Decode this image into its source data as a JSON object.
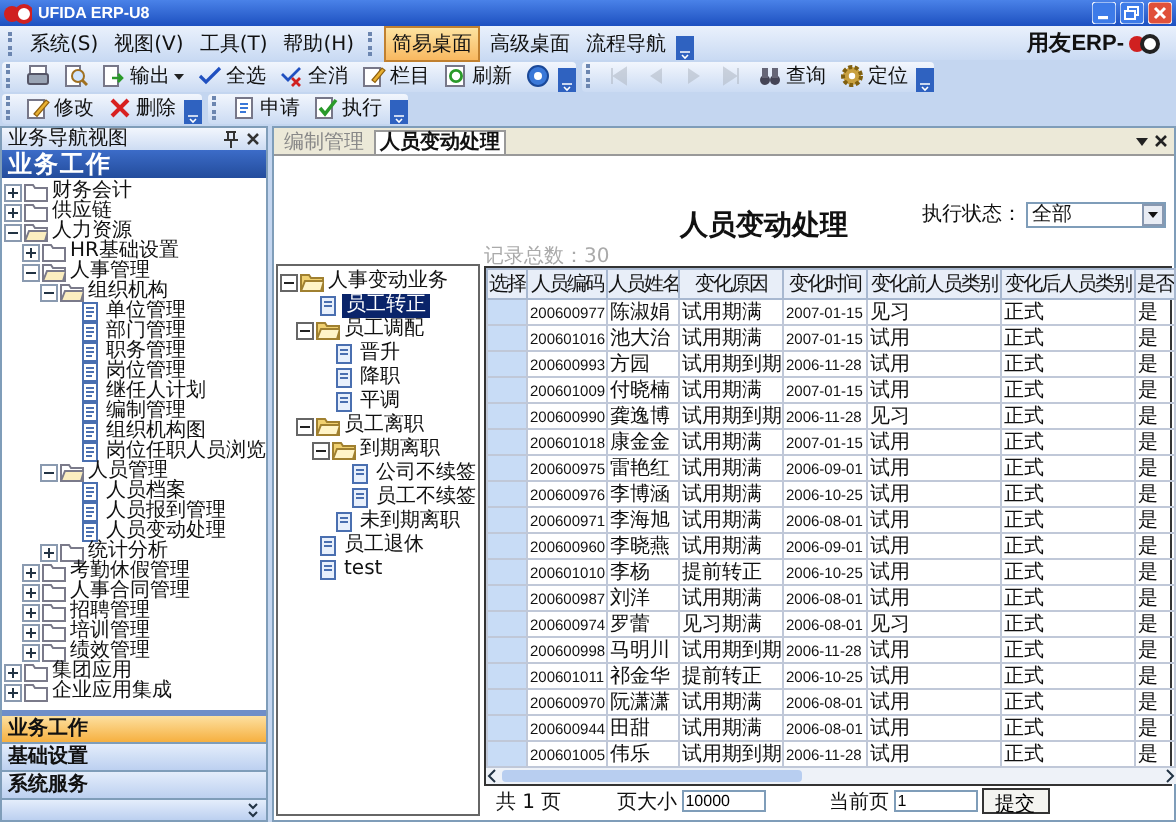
{
  "window": {
    "title": "UFIDA ERP-U8"
  },
  "menu": [
    "系统(S)",
    "视图(V)",
    "工具(T)",
    "帮助(H)"
  ],
  "desktop_tabs": [
    {
      "label": "简易桌面",
      "selected": true
    },
    {
      "label": "高级桌面",
      "selected": false
    },
    {
      "label": "流程导航",
      "selected": false
    }
  ],
  "brand": "用友ERP-",
  "toolbar_rows": [
    [
      [
        {
          "kind": "icon",
          "disabled": false
        },
        {
          "kind": "icon",
          "disabled": false
        },
        {
          "kind": "dropdown",
          "label": "输出",
          "disabled": false
        },
        {
          "kind": "button",
          "label": "全选",
          "disabled": false
        },
        {
          "kind": "button",
          "label": "全消",
          "disabled": false
        },
        {
          "kind": "button",
          "label": "栏目",
          "disabled": false
        },
        {
          "kind": "button",
          "label": "刷新",
          "disabled": false
        },
        {
          "kind": "icon",
          "disabled": false
        }
      ],
      [
        {
          "kind": "icon",
          "disabled": true
        },
        {
          "kind": "icon",
          "disabled": true
        },
        {
          "kind": "icon",
          "disabled": true
        },
        {
          "kind": "icon",
          "disabled": true
        },
        {
          "kind": "button",
          "label": "查询",
          "disabled": false
        },
        {
          "kind": "button",
          "label": "定位",
          "disabled": false
        }
      ]
    ],
    [
      [
        {
          "kind": "button",
          "label": "修改",
          "disabled": false
        },
        {
          "kind": "button",
          "label": "删除",
          "disabled": false
        }
      ],
      [
        {
          "kind": "button",
          "label": "申请",
          "disabled": false
        },
        {
          "kind": "button",
          "label": "执行",
          "disabled": false
        }
      ]
    ]
  ],
  "nav": {
    "title": "业务导航视图",
    "heading": "业务工作",
    "tree": [
      {
        "label": "财务会计",
        "kind": "folder",
        "expanded": false
      },
      {
        "label": "供应链",
        "kind": "folder",
        "expanded": false
      },
      {
        "label": "人力资源",
        "kind": "folder",
        "expanded": true,
        "children": [
          {
            "label": "HR基础设置",
            "kind": "folder",
            "expanded": false
          },
          {
            "label": "人事管理",
            "kind": "folder",
            "expanded": true,
            "children": [
              {
                "label": "组织机构",
                "kind": "folder",
                "expanded": true,
                "children": [
                  {
                    "label": "单位管理",
                    "kind": "doc"
                  },
                  {
                    "label": "部门管理",
                    "kind": "doc"
                  },
                  {
                    "label": "职务管理",
                    "kind": "doc"
                  },
                  {
                    "label": "岗位管理",
                    "kind": "doc"
                  },
                  {
                    "label": "继任人计划",
                    "kind": "doc"
                  },
                  {
                    "label": "编制管理",
                    "kind": "doc"
                  },
                  {
                    "label": "组织机构图",
                    "kind": "doc"
                  },
                  {
                    "label": "岗位任职人员浏览",
                    "kind": "doc"
                  }
                ]
              },
              {
                "label": "人员管理",
                "kind": "folder",
                "expanded": true,
                "children": [
                  {
                    "label": "人员档案",
                    "kind": "doc"
                  },
                  {
                    "label": "人员报到管理",
                    "kind": "doc"
                  },
                  {
                    "label": "人员变动处理",
                    "kind": "doc"
                  }
                ]
              },
              {
                "label": "统计分析",
                "kind": "folder",
                "expanded": false
              }
            ]
          },
          {
            "label": "考勤休假管理",
            "kind": "folder",
            "expanded": false
          },
          {
            "label": "人事合同管理",
            "kind": "folder",
            "expanded": false
          },
          {
            "label": "招聘管理",
            "kind": "folder",
            "expanded": false
          },
          {
            "label": "培训管理",
            "kind": "folder",
            "expanded": false
          },
          {
            "label": "绩效管理",
            "kind": "folder",
            "expanded": false
          }
        ]
      },
      {
        "label": "集团应用",
        "kind": "folder",
        "expanded": false
      },
      {
        "label": "企业应用集成",
        "kind": "folder",
        "expanded": false
      }
    ],
    "sections": [
      {
        "label": "业务工作",
        "selected": true
      },
      {
        "label": "基础设置",
        "selected": false
      },
      {
        "label": "系统服务",
        "selected": false
      }
    ]
  },
  "tabs": [
    {
      "label": "编制管理",
      "selected": false
    },
    {
      "label": "人员变动处理",
      "selected": true
    }
  ],
  "page": {
    "title": "人员变动处理",
    "record_count": "记录总数：30",
    "status_label": "执行状态：",
    "status_value": "全部"
  },
  "process_tree": [
    {
      "label": "人事变动业务",
      "kind": "folder",
      "expanded": true,
      "selected": false,
      "children": [
        {
          "label": "员工转正",
          "kind": "doc",
          "selected": true
        },
        {
          "label": "员工调配",
          "kind": "folder",
          "expanded": true,
          "selected": false,
          "children": [
            {
              "label": "晋升",
              "kind": "doc",
              "selected": false
            },
            {
              "label": "降职",
              "kind": "doc",
              "selected": false
            },
            {
              "label": "平调",
              "kind": "doc",
              "selected": false
            }
          ]
        },
        {
          "label": "员工离职",
          "kind": "folder",
          "expanded": true,
          "selected": false,
          "children": [
            {
              "label": "到期离职",
              "kind": "folder",
              "expanded": true,
              "selected": false,
              "children": [
                {
                  "label": "公司不续签",
                  "kind": "doc",
                  "selected": false
                },
                {
                  "label": "员工不续签",
                  "kind": "doc",
                  "selected": false
                }
              ]
            },
            {
              "label": "未到期离职",
              "kind": "doc",
              "selected": false
            }
          ]
        },
        {
          "label": "员工退休",
          "kind": "doc",
          "selected": false
        },
        {
          "label": "test",
          "kind": "doc",
          "selected": false
        }
      ]
    }
  ],
  "table": {
    "columns": [
      "选择",
      "人员编码",
      "人员姓名",
      "变化原因",
      "变化时间",
      "变化前人员类别",
      "变化后人员类别",
      "是否"
    ],
    "rows": [
      [
        "",
        "200600977",
        "陈淑娟",
        "试用期满",
        "2007-01-15",
        "见习",
        "正式",
        "是"
      ],
      [
        "",
        "200601016",
        "池大治",
        "试用期满",
        "2007-01-15",
        "试用",
        "正式",
        "是"
      ],
      [
        "",
        "200600993",
        "方园",
        "试用期到期",
        "2006-11-28",
        "试用",
        "正式",
        "是"
      ],
      [
        "",
        "200601009",
        "付晓楠",
        "试用期满",
        "2007-01-15",
        "试用",
        "正式",
        "是"
      ],
      [
        "",
        "200600990",
        "龚逸博",
        "试用期到期",
        "2006-11-28",
        "见习",
        "正式",
        "是"
      ],
      [
        "",
        "200601018",
        "康金金",
        "试用期满",
        "2007-01-15",
        "试用",
        "正式",
        "是"
      ],
      [
        "",
        "200600975",
        "雷艳红",
        "试用期满",
        "2006-09-01",
        "试用",
        "正式",
        "是"
      ],
      [
        "",
        "200600976",
        "李博涵",
        "试用期满",
        "2006-10-25",
        "试用",
        "正式",
        "是"
      ],
      [
        "",
        "200600971",
        "李海旭",
        "试用期满",
        "2006-08-01",
        "试用",
        "正式",
        "是"
      ],
      [
        "",
        "200600960",
        "李晓燕",
        "试用期满",
        "2006-09-01",
        "试用",
        "正式",
        "是"
      ],
      [
        "",
        "200601010",
        "李杨",
        "提前转正",
        "2006-10-25",
        "试用",
        "正式",
        "是"
      ],
      [
        "",
        "200600987",
        "刘洋",
        "试用期满",
        "2006-08-01",
        "试用",
        "正式",
        "是"
      ],
      [
        "",
        "200600974",
        "罗蕾",
        "见习期满",
        "2006-08-01",
        "见习",
        "正式",
        "是"
      ],
      [
        "",
        "200600998",
        "马明川",
        "试用期到期",
        "2006-11-28",
        "试用",
        "正式",
        "是"
      ],
      [
        "",
        "200601011",
        "祁金华",
        "提前转正",
        "2006-10-25",
        "试用",
        "正式",
        "是"
      ],
      [
        "",
        "200600970",
        "阮潇潇",
        "试用期满",
        "2006-08-01",
        "试用",
        "正式",
        "是"
      ],
      [
        "",
        "200600944",
        "田甜",
        "试用期满",
        "2006-08-01",
        "试用",
        "正式",
        "是"
      ],
      [
        "",
        "200601005",
        "伟乐",
        "试用期到期",
        "2006-11-28",
        "试用",
        "正式",
        "是"
      ]
    ]
  },
  "pager": {
    "pages": "共 1 页",
    "page_size_label": "页大小",
    "page_size": "10000",
    "current_page_label": "当前页",
    "current_page": "1",
    "submit": "提交"
  }
}
